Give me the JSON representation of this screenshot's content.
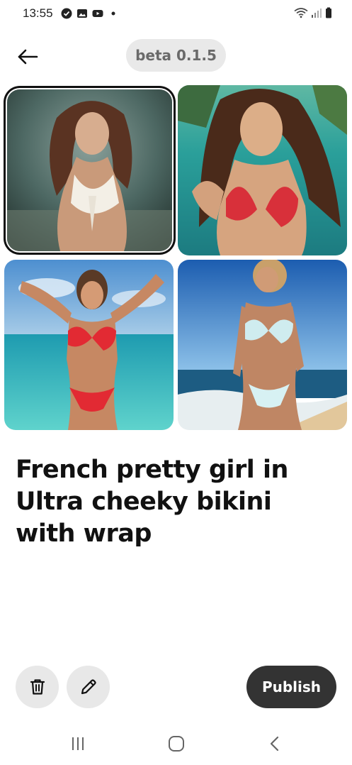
{
  "status_bar": {
    "time": "13:55",
    "left_icons": [
      "check-circle-icon",
      "gallery-icon",
      "youtube-icon",
      "dot-icon"
    ],
    "right_icons": [
      "wifi-icon",
      "signal-icon",
      "battery-icon"
    ]
  },
  "header": {
    "back_icon": "arrow-left-icon",
    "version": "beta 0.1.5"
  },
  "images": [
    {
      "name": "generated-image-1",
      "selected": true,
      "palette": {
        "bg": "#3f5a56",
        "accent": "#f3efe6",
        "skin": "#c99a7a"
      }
    },
    {
      "name": "generated-image-2",
      "selected": false,
      "palette": {
        "bg": "#2fa7a0",
        "accent": "#d8303a",
        "skin": "#d6a47f"
      }
    },
    {
      "name": "generated-image-3",
      "selected": false,
      "palette": {
        "bg": "#3ac0c9",
        "accent": "#e22a33",
        "skin": "#c68863"
      }
    },
    {
      "name": "generated-image-4",
      "selected": false,
      "palette": {
        "bg": "#2f80c8",
        "accent": "#cfecef",
        "skin": "#bf8664"
      }
    }
  ],
  "title": "French pretty girl in Ultra cheeky bikini with wrap",
  "actions": {
    "delete_icon": "trash-icon",
    "edit_icon": "pencil-icon",
    "publish_label": "Publish"
  },
  "nav": {
    "recents_icon": "recents-icon",
    "home_icon": "home-icon",
    "back_icon": "chevron-left-icon"
  },
  "colors": {
    "publish_bg": "#333333",
    "badge_bg": "#e9e9e9",
    "round_btn_bg": "#e8e8e8"
  }
}
